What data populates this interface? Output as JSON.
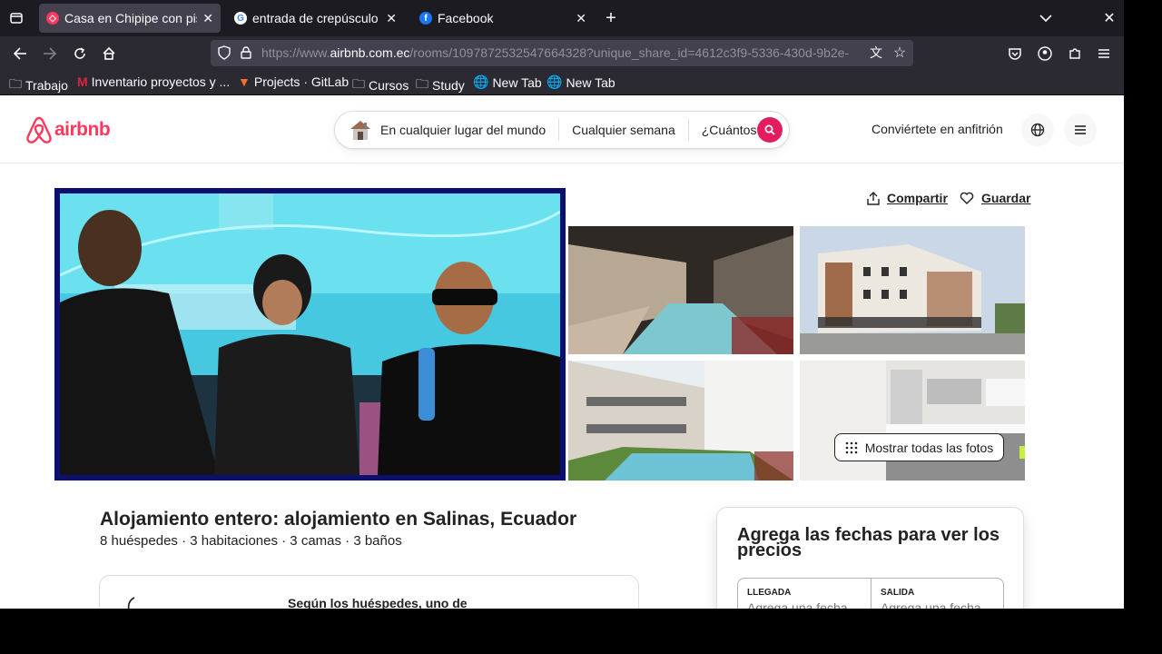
{
  "browser": {
    "tabs": [
      {
        "title": "Casa en Chipipe con piscina",
        "active": true,
        "favicon_color": "#ff385c"
      },
      {
        "title": "entrada de crepúsculo a la",
        "active": false,
        "favicon_color": "#4285f4"
      },
      {
        "title": "Facebook",
        "active": false,
        "favicon_color": "#1877f2"
      }
    ],
    "url_prefix": "https://www.",
    "url_domain": "airbnb.com.ec",
    "url_rest": "/rooms/1097872532547664328?unique_share_id=4612c3f9-5336-430d-9b2e-",
    "bookmarks": [
      "Trabajo",
      "Inventario proyectos y ...",
      "Projects · GitLab",
      "Cursos",
      "Study",
      "New Tab",
      "New Tab"
    ]
  },
  "header": {
    "logo": "airbnb",
    "search_location": "En cualquier lugar del mundo",
    "search_week": "Cualquier semana",
    "search_guests": "¿Cuántos?",
    "host_link": "Conviértete en anfitrión"
  },
  "listing": {
    "share_label": "Compartir",
    "save_label": "Guardar",
    "show_all_photos": "Mostrar todas las fotos",
    "type_heading": "Alojamiento entero: alojamiento en Salinas, Ecuador",
    "details": "8 huéspedes · 3 habitaciones · 3 camas · 3 baños",
    "highlight": "Según los huéspedes, uno de"
  },
  "booking": {
    "title": "Agrega las fechas para ver los precios",
    "checkin_label": "LLEGADA",
    "checkin_placeholder": "Agrega una fecha",
    "checkout_label": "SALIDA",
    "checkout_placeholder": "Agrega una fecha"
  },
  "colors": {
    "brand": "#ff385c",
    "search_button": "#e31c5f",
    "overlay_frame": "#0b0f70"
  }
}
